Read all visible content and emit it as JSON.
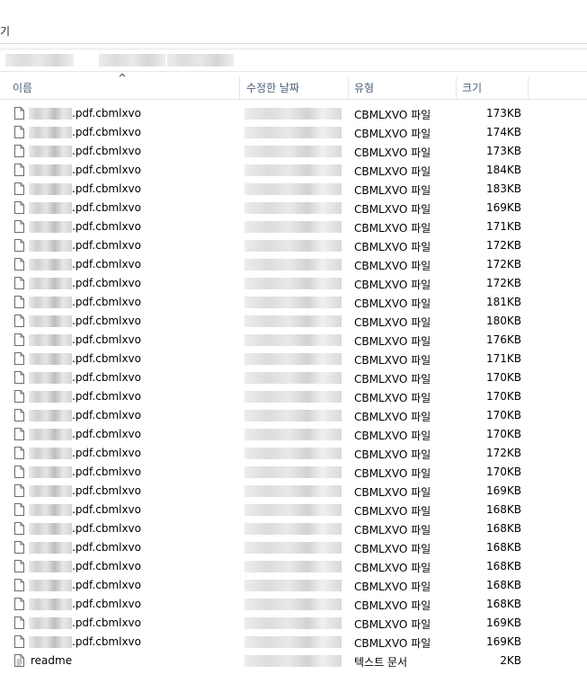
{
  "window": {
    "title_fragment": "기"
  },
  "columns": {
    "name": "이름",
    "modified": "수정한 날짜",
    "type": "유형",
    "size": "크기"
  },
  "sort_indicator": "^",
  "files": [
    {
      "name": ".pdf.cbmlxvo",
      "type": "CBMLXVO 파일",
      "size": "173KB",
      "icon": "file-icon"
    },
    {
      "name": ".pdf.cbmlxvo",
      "type": "CBMLXVO 파일",
      "size": "174KB",
      "icon": "file-icon"
    },
    {
      "name": ".pdf.cbmlxvo",
      "type": "CBMLXVO 파일",
      "size": "173KB",
      "icon": "file-icon"
    },
    {
      "name": ".pdf.cbmlxvo",
      "type": "CBMLXVO 파일",
      "size": "184KB",
      "icon": "file-icon"
    },
    {
      "name": ".pdf.cbmlxvo",
      "type": "CBMLXVO 파일",
      "size": "183KB",
      "icon": "file-icon"
    },
    {
      "name": ".pdf.cbmlxvo",
      "type": "CBMLXVO 파일",
      "size": "169KB",
      "icon": "file-icon"
    },
    {
      "name": ".pdf.cbmlxvo",
      "type": "CBMLXVO 파일",
      "size": "171KB",
      "icon": "file-icon"
    },
    {
      "name": ".pdf.cbmlxvo",
      "type": "CBMLXVO 파일",
      "size": "172KB",
      "icon": "file-icon"
    },
    {
      "name": ".pdf.cbmlxvo",
      "type": "CBMLXVO 파일",
      "size": "172KB",
      "icon": "file-icon"
    },
    {
      "name": ".pdf.cbmlxvo",
      "type": "CBMLXVO 파일",
      "size": "172KB",
      "icon": "file-icon"
    },
    {
      "name": ".pdf.cbmlxvo",
      "type": "CBMLXVO 파일",
      "size": "181KB",
      "icon": "file-icon"
    },
    {
      "name": ".pdf.cbmlxvo",
      "type": "CBMLXVO 파일",
      "size": "180KB",
      "icon": "file-icon"
    },
    {
      "name": ".pdf.cbmlxvo",
      "type": "CBMLXVO 파일",
      "size": "176KB",
      "icon": "file-icon"
    },
    {
      "name": ".pdf.cbmlxvo",
      "type": "CBMLXVO 파일",
      "size": "171KB",
      "icon": "file-icon"
    },
    {
      "name": ".pdf.cbmlxvo",
      "type": "CBMLXVO 파일",
      "size": "170KB",
      "icon": "file-icon"
    },
    {
      "name": ".pdf.cbmlxvo",
      "type": "CBMLXVO 파일",
      "size": "170KB",
      "icon": "file-icon"
    },
    {
      "name": ".pdf.cbmlxvo",
      "type": "CBMLXVO 파일",
      "size": "170KB",
      "icon": "file-icon"
    },
    {
      "name": ".pdf.cbmlxvo",
      "type": "CBMLXVO 파일",
      "size": "170KB",
      "icon": "file-icon"
    },
    {
      "name": ".pdf.cbmlxvo",
      "type": "CBMLXVO 파일",
      "size": "172KB",
      "icon": "file-icon"
    },
    {
      "name": ".pdf.cbmlxvo",
      "type": "CBMLXVO 파일",
      "size": "170KB",
      "icon": "file-icon"
    },
    {
      "name": ".pdf.cbmlxvo",
      "type": "CBMLXVO 파일",
      "size": "169KB",
      "icon": "file-icon"
    },
    {
      "name": ".pdf.cbmlxvo",
      "type": "CBMLXVO 파일",
      "size": "168KB",
      "icon": "file-icon"
    },
    {
      "name": ".pdf.cbmlxvo",
      "type": "CBMLXVO 파일",
      "size": "168KB",
      "icon": "file-icon"
    },
    {
      "name": ".pdf.cbmlxvo",
      "type": "CBMLXVO 파일",
      "size": "168KB",
      "icon": "file-icon"
    },
    {
      "name": ".pdf.cbmlxvo",
      "type": "CBMLXVO 파일",
      "size": "168KB",
      "icon": "file-icon"
    },
    {
      "name": ".pdf.cbmlxvo",
      "type": "CBMLXVO 파일",
      "size": "168KB",
      "icon": "file-icon"
    },
    {
      "name": ".pdf.cbmlxvo",
      "type": "CBMLXVO 파일",
      "size": "168KB",
      "icon": "file-icon"
    },
    {
      "name": ".pdf.cbmlxvo",
      "type": "CBMLXVO 파일",
      "size": "169KB",
      "icon": "file-icon"
    },
    {
      "name": ".pdf.cbmlxvo",
      "type": "CBMLXVO 파일",
      "size": "169KB",
      "icon": "file-icon"
    },
    {
      "name": "readme",
      "type": "텍스트 문서",
      "size": "2KB",
      "icon": "text-document-icon"
    }
  ]
}
